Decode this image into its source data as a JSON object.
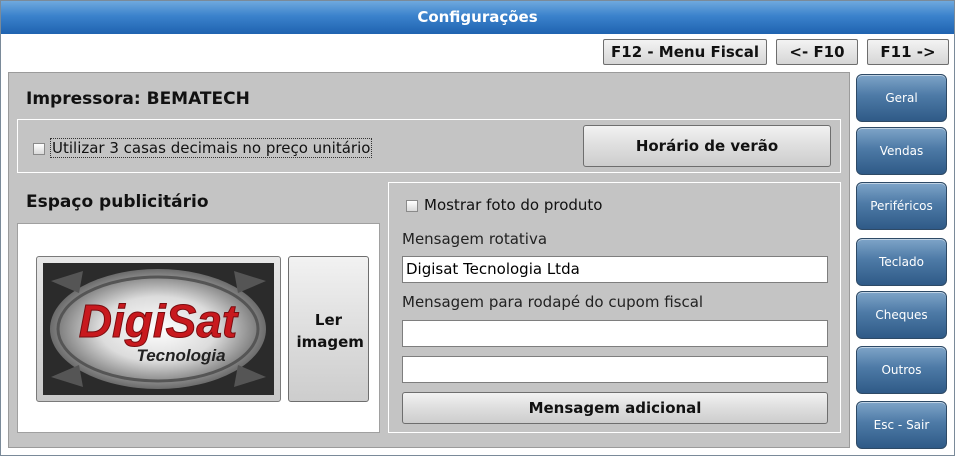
{
  "window": {
    "title": "Configurações"
  },
  "top_buttons": {
    "menu_fiscal": "F12 - Menu Fiscal",
    "prev": "<- F10",
    "next": "F11 ->"
  },
  "printer": {
    "title": "Impressora: BEMATECH"
  },
  "decimals": {
    "label": "Utilizar 3 casas decimais no preço unitário",
    "checked": false
  },
  "daylight_button": "Horário de verão",
  "ad_space": {
    "title": "Espaço publicitário",
    "logo_text": "DigiSat",
    "logo_subtext": "Tecnologia",
    "read_image_button": "Ler imagem"
  },
  "product_photo": {
    "label": "Mostrar foto do produto",
    "checked": false
  },
  "rotating_message": {
    "label": "Mensagem rotativa",
    "value": "Digisat Tecnologia Ltda"
  },
  "footer_message": {
    "label": "Mensagem para rodapé do cupom fiscal",
    "line1": "",
    "line2": ""
  },
  "additional_message_button": "Mensagem adicional",
  "sidebar": {
    "items": [
      {
        "label": "Geral"
      },
      {
        "label": "Vendas"
      },
      {
        "label": "Periféricos"
      },
      {
        "label": "Teclado"
      },
      {
        "label": "Cheques"
      },
      {
        "label": "Outros"
      },
      {
        "label": "Esc - Sair"
      }
    ]
  }
}
